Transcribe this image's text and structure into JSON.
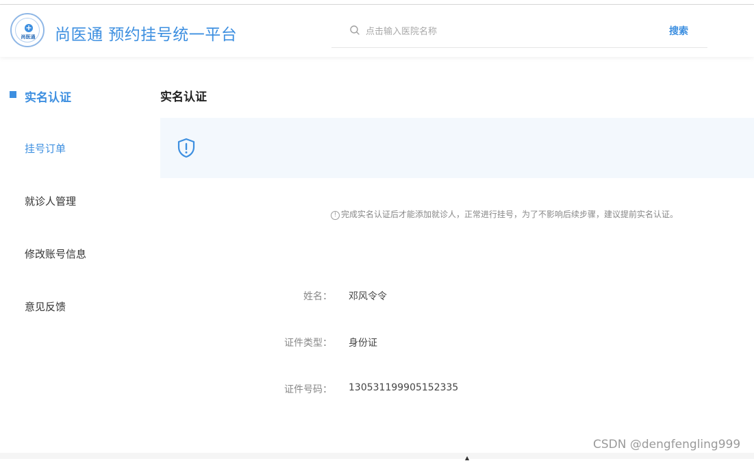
{
  "header": {
    "logo_text": "尚医通",
    "app_title": "尚医通 预约挂号统一平台",
    "search": {
      "placeholder": "点击输入医院名称",
      "value": "",
      "button_label": "搜索"
    }
  },
  "sidebar": {
    "items": [
      {
        "label": "实名认证",
        "active": true
      },
      {
        "label": "挂号订单",
        "active": false
      },
      {
        "label": "就诊人管理",
        "active": false
      },
      {
        "label": "修改账号信息",
        "active": false
      },
      {
        "label": "意见反馈",
        "active": false
      }
    ]
  },
  "main": {
    "title": "实名认证",
    "tip_text": "完成实名认证后才能添加就诊人，正常进行挂号，为了不影响后续步骤，建议提前实名认证。",
    "tip_icon": "info-icon",
    "banner_icon": "shield-alert-icon",
    "fields": [
      {
        "label": "姓名：",
        "value": "邓风令令"
      },
      {
        "label": "证件类型：",
        "value": "身份证"
      },
      {
        "label": "证件号码：",
        "value": "130531199905152335"
      }
    ]
  },
  "watermark": "CSDN @dengfengling999",
  "colors": {
    "accent": "#3d8fe0",
    "banner_bg": "#f3f8fd",
    "muted": "#888888"
  }
}
